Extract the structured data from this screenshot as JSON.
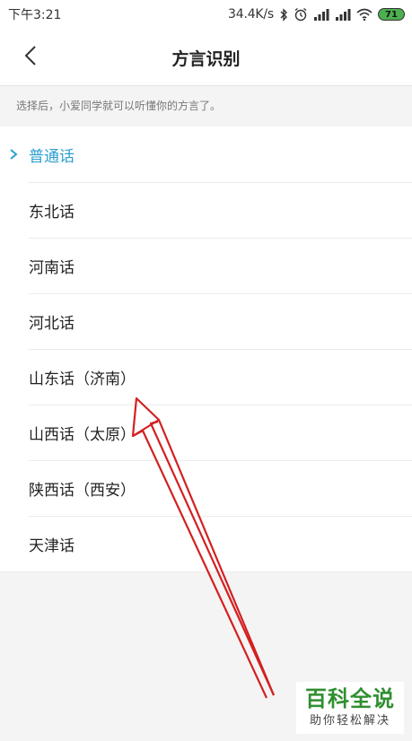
{
  "status_bar": {
    "time": "下午3:21",
    "speed": "34.4K/s",
    "battery": "71"
  },
  "header": {
    "title": "方言识别",
    "back_icon": "chevron-left-icon"
  },
  "hint": "选择后，小爱同学就可以听懂你的方言了。",
  "dialects": {
    "items": [
      {
        "label": "普通话",
        "selected": true
      },
      {
        "label": "东北话",
        "selected": false
      },
      {
        "label": "河南话",
        "selected": false
      },
      {
        "label": "河北话",
        "selected": false
      },
      {
        "label": "山东话（济南）",
        "selected": false
      },
      {
        "label": "山西话（太原）",
        "selected": false
      },
      {
        "label": "陕西话（西安）",
        "selected": false
      },
      {
        "label": "天津话",
        "selected": false
      }
    ]
  },
  "colors": {
    "accent": "#2b9fd1",
    "annotation": "#d32020",
    "watermark": "#2f8f2f"
  },
  "watermark": {
    "title": "百科全说",
    "subtitle": "助你轻松解决"
  }
}
